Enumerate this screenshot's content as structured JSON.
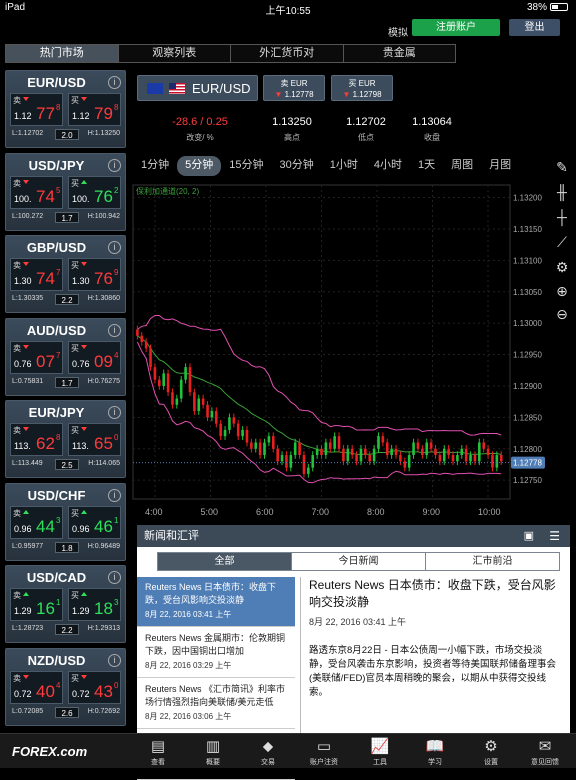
{
  "status": {
    "left": "iPad",
    "time": "上午10:55",
    "battery": "38%"
  },
  "top": {
    "mock": "模拟",
    "register": "注册账户",
    "login": "登出"
  },
  "tabs": [
    "热门市场",
    "观察列表",
    "外汇货币对",
    "贵金属"
  ],
  "pairs": [
    {
      "name": "EUR/USD",
      "sell_pre": "1.12",
      "sell_big": "77",
      "sell_sup": "8",
      "buy_pre": "1.12",
      "buy_big": "79",
      "buy_sup": "8",
      "low": "L:1.12702",
      "spread": "2.0",
      "high": "H:1.13250",
      "sell_color": "red",
      "buy_color": "red"
    },
    {
      "name": "USD/JPY",
      "sell_pre": "100.",
      "sell_big": "74",
      "sell_sup": "5",
      "buy_pre": "100.",
      "buy_big": "76",
      "buy_sup": "2",
      "low": "L:100.272",
      "spread": "1.7",
      "high": "H:100.942",
      "sell_color": "red",
      "buy_color": "grn"
    },
    {
      "name": "GBP/USD",
      "sell_pre": "1.30",
      "sell_big": "74",
      "sell_sup": "7",
      "buy_pre": "1.30",
      "buy_big": "76",
      "buy_sup": "9",
      "low": "L:1.30335",
      "spread": "2.2",
      "high": "H:1.30860",
      "sell_color": "red",
      "buy_color": "red"
    },
    {
      "name": "AUD/USD",
      "sell_pre": "0.76",
      "sell_big": "07",
      "sell_sup": "7",
      "buy_pre": "0.76",
      "buy_big": "09",
      "buy_sup": "4",
      "low": "L:0.75831",
      "spread": "1.7",
      "high": "H:0.76275",
      "sell_color": "red",
      "buy_color": "red"
    },
    {
      "name": "EUR/JPY",
      "sell_pre": "113.",
      "sell_big": "62",
      "sell_sup": "8",
      "buy_pre": "113.",
      "buy_big": "65",
      "buy_sup": "0",
      "low": "L:113.449",
      "spread": "2.5",
      "high": "H:114.065",
      "sell_color": "red",
      "buy_color": "red"
    },
    {
      "name": "USD/CHF",
      "sell_pre": "0.96",
      "sell_big": "44",
      "sell_sup": "3",
      "buy_pre": "0.96",
      "buy_big": "46",
      "buy_sup": "1",
      "low": "L:0.95977",
      "spread": "1.8",
      "high": "H:0.96489",
      "sell_color": "grn",
      "buy_color": "grn"
    },
    {
      "name": "USD/CAD",
      "sell_pre": "1.29",
      "sell_big": "16",
      "sell_sup": "1",
      "buy_pre": "1.29",
      "buy_big": "18",
      "buy_sup": "3",
      "low": "L:1.28723",
      "spread": "2.2",
      "high": "H:1.29313",
      "sell_color": "grn",
      "buy_color": "grn"
    },
    {
      "name": "NZD/USD",
      "sell_pre": "0.72",
      "sell_big": "40",
      "sell_sup": "4",
      "buy_pre": "0.72",
      "buy_big": "43",
      "buy_sup": "0",
      "low": "L:0.72085",
      "spread": "2.6",
      "high": "H:0.72692",
      "sell_color": "red",
      "buy_color": "red"
    }
  ],
  "quote_labels": {
    "sell": "卖",
    "buy": "买"
  },
  "selected": {
    "pair": "EUR/USD",
    "sell_label": "卖 EUR",
    "sell_price": "1.12778",
    "buy_label": "买 EUR",
    "buy_price": "1.12798",
    "change": "-28.6 / 0.25",
    "change_label": "改变/ %",
    "high": "1.13250",
    "high_label": "高点",
    "low": "1.12702",
    "low_label": "低点",
    "close": "1.13064",
    "close_label": "收盘"
  },
  "timeframes": [
    "1分钟",
    "5分钟",
    "15分钟",
    "30分钟",
    "1小时",
    "4小时",
    "1天",
    "周图",
    "月图"
  ],
  "timeframe_active": 1,
  "chart_data": {
    "type": "candlestick",
    "indicator": "保利加通道(20, 2)",
    "x_ticks": [
      "4:00",
      "5:00",
      "6:00",
      "7:00",
      "8:00",
      "9:00",
      "10:00"
    ],
    "y_ticks": [
      "1.12750",
      "1.12800",
      "1.12850",
      "1.12900",
      "1.12950",
      "1.13000",
      "1.13050",
      "1.13100",
      "1.13150",
      "1.13200"
    ],
    "ylim": [
      1.1272,
      1.1322
    ],
    "current_price": "1.12778",
    "colors": {
      "up": "#22c23a",
      "down": "#e8201f",
      "band": "#e050b0",
      "mid": "#3aa03a",
      "current": "#4f7db5"
    },
    "close": [
      1.1298,
      1.1297,
      1.1296,
      1.1293,
      1.1291,
      1.129,
      1.1292,
      1.1289,
      1.1287,
      1.1288,
      1.1291,
      1.1293,
      1.1289,
      1.1286,
      1.1288,
      1.1287,
      1.1285,
      1.1286,
      1.1284,
      1.1282,
      1.1283,
      1.1285,
      1.1284,
      1.1282,
      1.1283,
      1.1281,
      1.128,
      1.1281,
      1.1279,
      1.1281,
      1.1282,
      1.128,
      1.1278,
      1.1279,
      1.1277,
      1.1279,
      1.1281,
      1.1279,
      1.1276,
      1.1277,
      1.1279,
      1.128,
      1.1279,
      1.1281,
      1.128,
      1.1282,
      1.128,
      1.1278,
      1.128,
      1.1279,
      1.1278,
      1.128,
      1.1279,
      1.1278,
      1.128,
      1.1282,
      1.1281,
      1.1279,
      1.128,
      1.1279,
      1.1278,
      1.1277,
      1.1279,
      1.1281,
      1.128,
      1.1279,
      1.1281,
      1.128,
      1.1279,
      1.1278,
      1.128,
      1.1279,
      1.1278,
      1.1279,
      1.128,
      1.1278,
      1.1279,
      1.1278,
      1.1281,
      1.128,
      1.1279,
      1.1277,
      1.1279,
      1.1278
    ]
  },
  "news": {
    "title": "新闻和汇评",
    "tabs": [
      "全部",
      "今日新闻",
      "汇市前沿"
    ],
    "items": [
      {
        "title": "Reuters News 日本债市：收盘下跌，受台风影响交投淡静",
        "date": "8月 22, 2016 03:41 上午"
      },
      {
        "title": "Reuters News 金属期市：伦敦期铜下跌，因中国铜出口增加",
        "date": "8月 22, 2016 03:29 上午"
      },
      {
        "title": "Reuters News 《汇市简讯》利率市场行情强烈指向美联储/美元走低",
        "date": "8月 22, 2016 03:06 上午"
      },
      {
        "title": "Reuters News 国际油市：油价下",
        "date": ""
      }
    ],
    "article": {
      "headline": "Reuters News 日本债市：收盘下跌，受台风影响交投淡静",
      "date": "8月 22, 2016 03:41 上午",
      "body": "路透东京8月22日 - 日本公债周一小幅下跌，市场交投淡静，受台风袭击东京影响，投资者等待美国联邦储备理事会(美联储/FED)官员本周稍晚的聚会，以期从中获得交投线索。"
    }
  },
  "bottom": {
    "logo": "FOREX.com",
    "nav": [
      "查看",
      "概要",
      "交易",
      "账户注资",
      "工具",
      "学习",
      "设置",
      "意见回馈"
    ]
  }
}
